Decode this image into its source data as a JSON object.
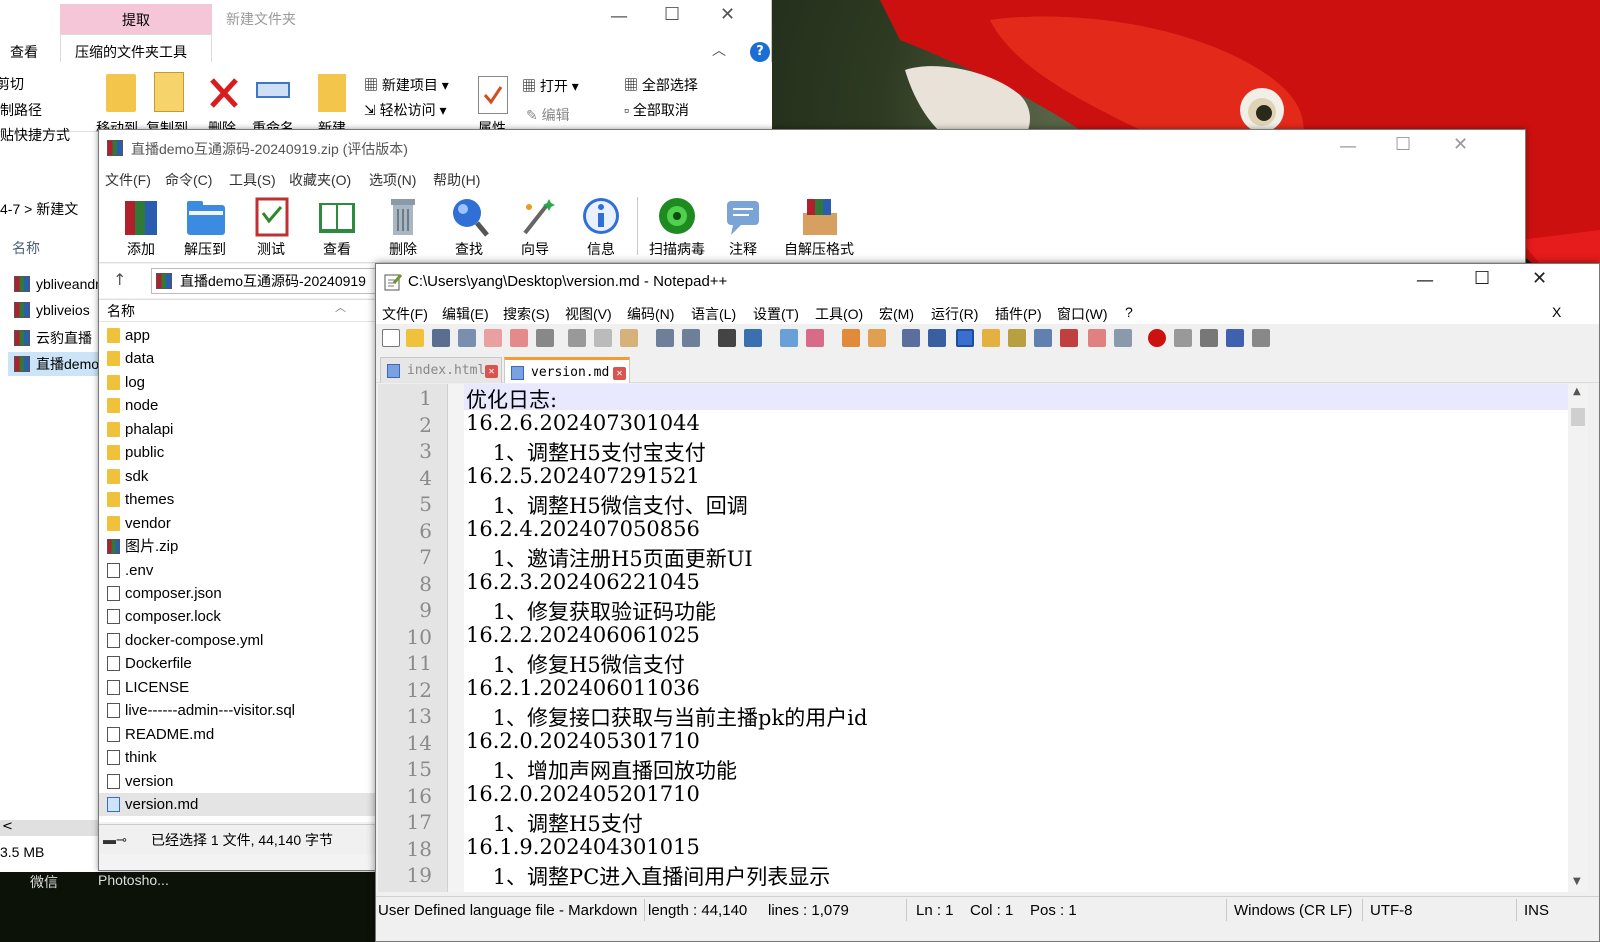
{
  "explorer": {
    "quick_title": "新建文件夹",
    "tabs": {
      "extract": "提取",
      "view": "查看",
      "tools": "压缩的文件夹工具"
    },
    "ribbon": {
      "cut": "剪切",
      "copy_path": "复制路径",
      "paste_shortcut": "粘贴快捷方式",
      "move_to": "移动到",
      "copy_to": "复制到",
      "delete": "删除",
      "rename": "重命名",
      "new": "新建",
      "new_item": "新建项目",
      "easy_access": "轻松访问",
      "properties": "属性",
      "open": "打开",
      "edit": "编辑",
      "select_all": "全部选择",
      "select_none": "全部取消"
    },
    "breadcrumb": {
      "prefix": "4-7",
      "sep": ">",
      "folder": "新建文"
    },
    "column_name": "名称",
    "side_items": [
      "ybliveandroid",
      "ybliveios",
      "云豹直播",
      "直播demo"
    ],
    "size_text": "3.5 MB",
    "scroll_left": "<"
  },
  "taskbar": {
    "a": "微信",
    "b": "Photosho..."
  },
  "winrar": {
    "title": "直播demo互通源码-20240919.zip (评估版本)",
    "menu": [
      "文件(F)",
      "命令(C)",
      "工具(S)",
      "收藏夹(O)",
      "选项(N)",
      "帮助(H)"
    ],
    "toolbar": [
      "添加",
      "解压到",
      "测试",
      "查看",
      "删除",
      "查找",
      "向导",
      "信息",
      "扫描病毒",
      "注释",
      "自解压格式"
    ],
    "path": "直播demo互通源码-20240919",
    "up_arrow": "↑",
    "column_name": "名称",
    "files": [
      {
        "name": "app",
        "type": "folder"
      },
      {
        "name": "data",
        "type": "folder"
      },
      {
        "name": "log",
        "type": "folder"
      },
      {
        "name": "node",
        "type": "folder"
      },
      {
        "name": "phalapi",
        "type": "folder"
      },
      {
        "name": "public",
        "type": "folder"
      },
      {
        "name": "sdk",
        "type": "folder"
      },
      {
        "name": "themes",
        "type": "folder"
      },
      {
        "name": "vendor",
        "type": "folder"
      },
      {
        "name": "图片.zip",
        "type": "zip"
      },
      {
        "name": ".env",
        "type": "file"
      },
      {
        "name": "composer.json",
        "type": "file"
      },
      {
        "name": "composer.lock",
        "type": "file"
      },
      {
        "name": "docker-compose.yml",
        "type": "file"
      },
      {
        "name": "Dockerfile",
        "type": "file"
      },
      {
        "name": "LICENSE",
        "type": "file"
      },
      {
        "name": "live------admin---visitor.sql",
        "type": "file"
      },
      {
        "name": "README.md",
        "type": "file"
      },
      {
        "name": "think",
        "type": "file"
      },
      {
        "name": "version",
        "type": "file"
      },
      {
        "name": "version.md",
        "type": "md",
        "selected": true
      }
    ],
    "status": "已经选择 1 文件, 44,140 字节"
  },
  "notepad": {
    "title": "C:\\Users\\yang\\Desktop\\version.md - Notepad++",
    "menu": [
      "文件(F)",
      "编辑(E)",
      "搜索(S)",
      "视图(V)",
      "编码(N)",
      "语言(L)",
      "设置(T)",
      "工具(O)",
      "宏(M)",
      "运行(R)",
      "插件(P)",
      "窗口(W)",
      "?"
    ],
    "close_x": "X",
    "tabs": [
      {
        "label": "index.html",
        "active": false
      },
      {
        "label": "version.md",
        "active": true
      }
    ],
    "lines": [
      "优化日志:",
      "16.2.6.202407301044",
      "    1、调整H5支付宝支付",
      "16.2.5.202407291521",
      "    1、调整H5微信支付、回调",
      "16.2.4.202407050856",
      "    1、邀请注册H5页面更新UI",
      "16.2.3.202406221045",
      "    1、修复获取验证码功能",
      "16.2.2.202406061025",
      "    1、修复H5微信支付",
      "16.2.1.202406011036",
      "    1、修复接口获取与当前主播pk的用户id",
      "16.2.0.202405301710",
      "    1、增加声网直播回放功能",
      "16.2.0.202405201710",
      "    1、调整H5支付",
      "16.1.9.202404301015",
      "    1、调整PC进入直播间用户列表显示"
    ],
    "status": {
      "lang": "User Defined language file - Markdown",
      "length": "length : 44,140",
      "lines": "lines : 1,079",
      "ln": "Ln : 1",
      "col": "Col : 1",
      "pos": "Pos : 1",
      "eol": "Windows (CR LF)",
      "enc": "UTF-8",
      "mode": "INS"
    }
  },
  "colors": {
    "parrot_red": "#d01010",
    "tab_accent": "#fa9a34",
    "current_line": "#e8e8ff"
  }
}
